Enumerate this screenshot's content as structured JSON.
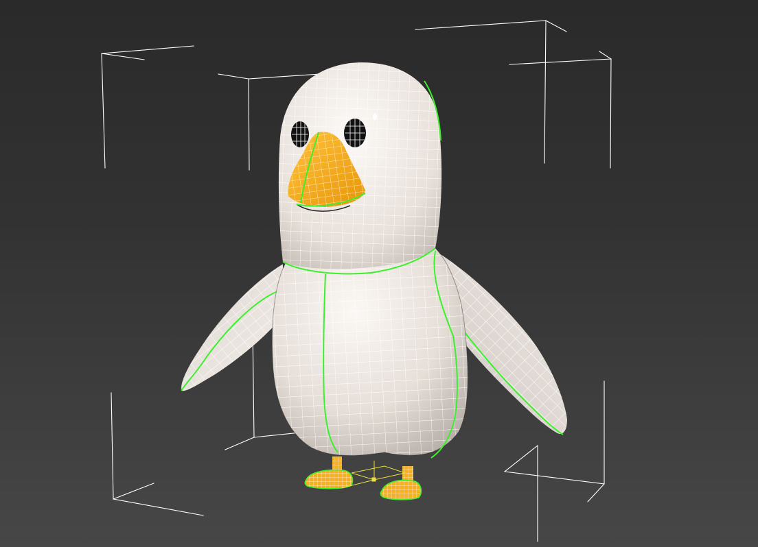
{
  "viewport": {
    "background_top": "#2a2a2a",
    "background_bottom": "#474747",
    "selection_bracket_color": "#ffffff",
    "object_color": "#ece6e0",
    "wireframe_color": "#ffffff",
    "beak_color": "#f6a810",
    "feet_color": "#f6b21a",
    "seam_color": "#3cf02c",
    "pivot_gizmo_color": "#e8e040"
  },
  "model": {
    "subject": "penguin",
    "display_mode": "shaded-with-edged-faces",
    "selected": true
  }
}
